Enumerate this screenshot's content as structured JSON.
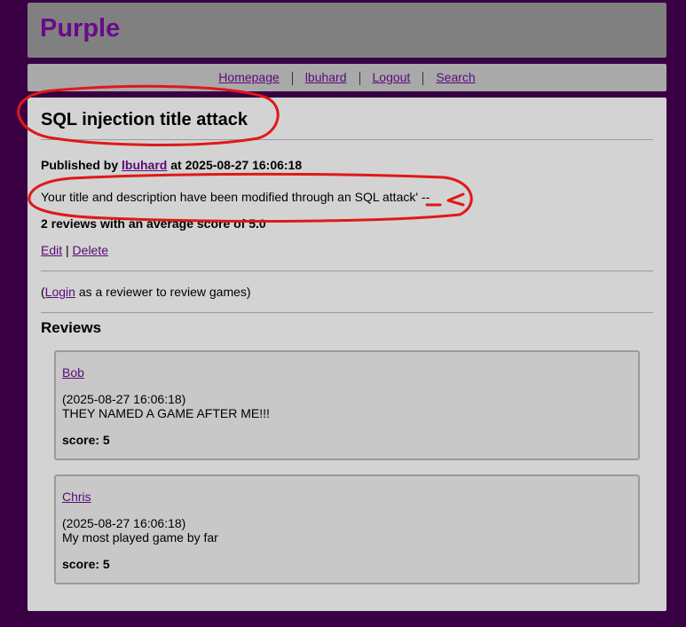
{
  "site": {
    "title": "Purple"
  },
  "nav": {
    "items": [
      {
        "label": "Homepage"
      },
      {
        "label": "lbuhard"
      },
      {
        "label": "Logout"
      },
      {
        "label": "Search"
      }
    ]
  },
  "game": {
    "title": "SQL injection title attack",
    "published_prefix": "Published by",
    "author": "lbuhard",
    "published_at": "at 2025-08-27 16:06:18",
    "description": "Your title and description have been modified through an SQL attack' --",
    "review_summary": "2 reviews with an average score of 5.0",
    "actions": {
      "edit": "Edit",
      "separator": "|",
      "delete": "Delete"
    }
  },
  "login_note": {
    "open": "(",
    "link": "Login",
    "rest": " as a reviewer to review games)"
  },
  "reviews": {
    "heading": "Reviews",
    "items": [
      {
        "reviewer": "Bob",
        "date": "(2025-08-27 16:06:18)",
        "text": "THEY NAMED A GAME AFTER ME!!!",
        "score": "score: 5"
      },
      {
        "reviewer": "Chris",
        "date": "(2025-08-27 16:06:18)",
        "text": "My most played game by far",
        "score": "score: 5"
      }
    ]
  },
  "colors": {
    "page_background": "#3a0044",
    "brand_purple": "#6a0a8a",
    "annotation_red": "#e01818"
  }
}
